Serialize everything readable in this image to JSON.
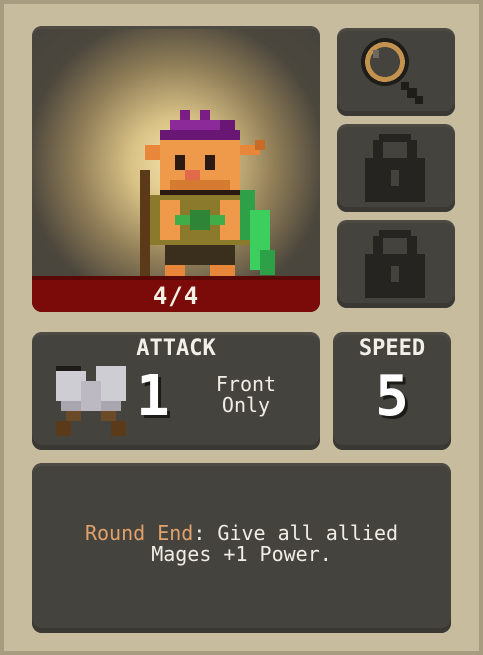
{
  "unit": {
    "health": "4/4"
  },
  "side_buttons": [
    {
      "icon": "magnifier-icon"
    },
    {
      "icon": "lock-icon"
    },
    {
      "icon": "lock-icon"
    }
  ],
  "attack": {
    "heading": "ATTACK",
    "value": "1",
    "target": "Front\nOnly",
    "icon": "crossed-swords-icon"
  },
  "speed": {
    "heading": "SPEED",
    "value": "5"
  },
  "ability": {
    "keyword": "Round End",
    "separator": ":",
    "text": " Give all allied",
    "text_line2": "Mages +1 Power."
  },
  "colors": {
    "panel": "#45433d",
    "card_bg": "#c8bc9f",
    "health_bar": "#7a0b08",
    "keyword": "#e0a16a"
  }
}
